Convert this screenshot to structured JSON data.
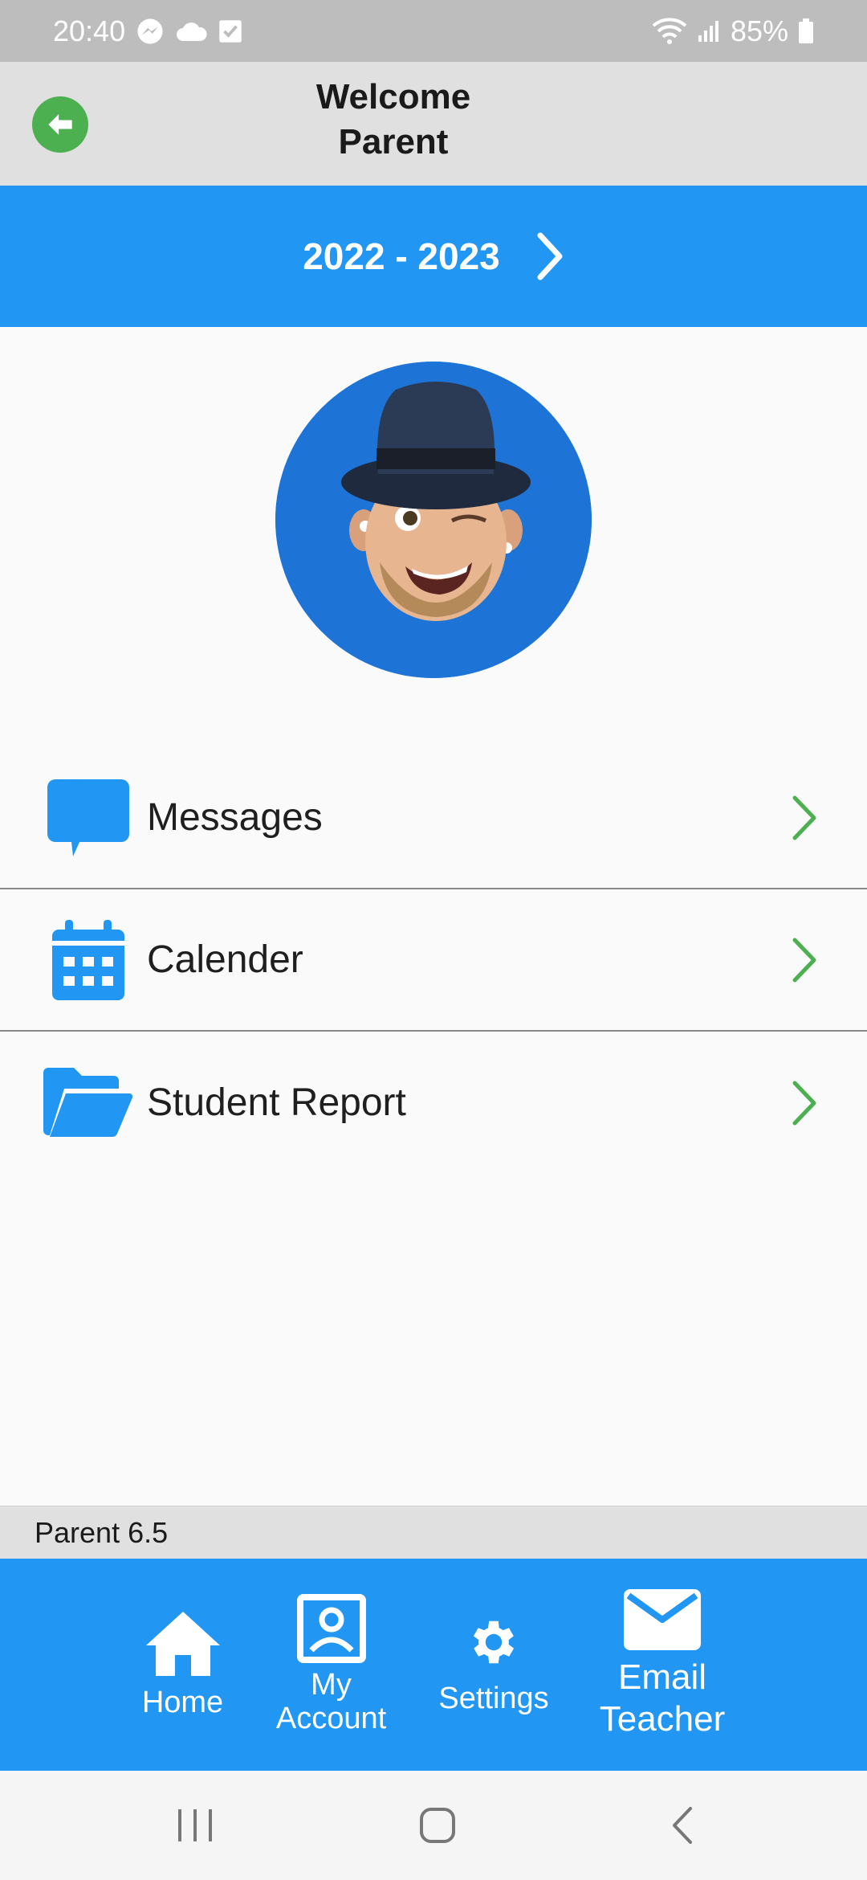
{
  "status_bar": {
    "time": "20:40",
    "battery": "85%",
    "left_icons": [
      "messenger-icon",
      "cloud-icon",
      "checkbox-icon"
    ],
    "right_icons": [
      "wifi-icon",
      "signal-icon",
      "battery-icon"
    ]
  },
  "header": {
    "title_line1": "Welcome",
    "title_line2": "Parent",
    "back_icon": "back-arrow-icon"
  },
  "year_selector": {
    "label": "2022 - 2023"
  },
  "menu": {
    "items": [
      {
        "label": "Messages",
        "icon": "chat-bubble-icon"
      },
      {
        "label": "Calender",
        "icon": "calendar-icon"
      },
      {
        "label": "Student Report",
        "icon": "folder-open-icon"
      }
    ]
  },
  "version": "Parent 6.5",
  "bottom_nav": {
    "items": [
      {
        "label_line1": "Home",
        "label_line2": "",
        "icon": "home-icon"
      },
      {
        "label_line1": "My",
        "label_line2": "Account",
        "icon": "account-icon"
      },
      {
        "label_line1": "Settings",
        "label_line2": "",
        "icon": "gear-icon"
      },
      {
        "label_line1": "Email",
        "label_line2": "Teacher",
        "icon": "mail-icon"
      }
    ]
  },
  "colors": {
    "primary": "#2196f3",
    "accent_green": "#4caf50",
    "header_bg": "#e0e0e0",
    "status_bar_bg": "#bdbdbd"
  }
}
